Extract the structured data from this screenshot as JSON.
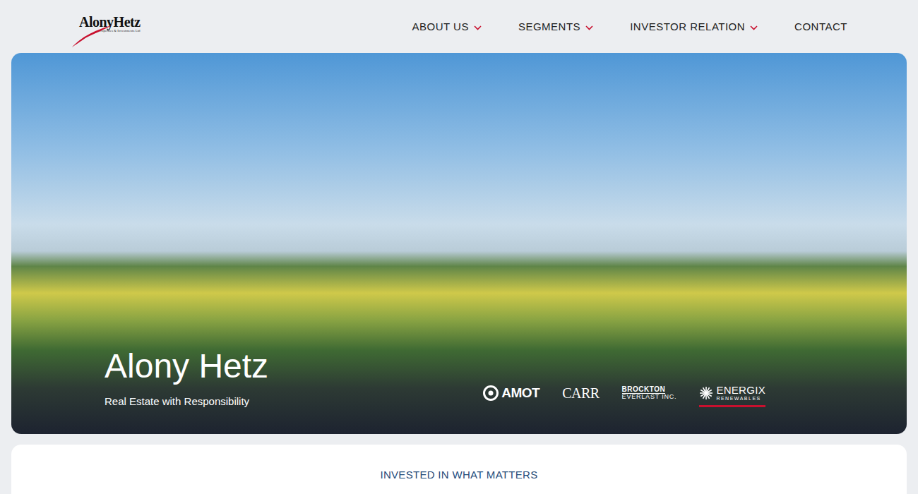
{
  "logo": {
    "name": "AlonyHetz",
    "tagline": "Properties & Investments Ltd"
  },
  "nav": [
    {
      "label": "ABOUT US",
      "dropdown": true
    },
    {
      "label": "SEGMENTS",
      "dropdown": true
    },
    {
      "label": "INVESTOR RELATION",
      "dropdown": true
    },
    {
      "label": "CONTACT",
      "dropdown": false
    }
  ],
  "hero": {
    "title": "Alony Hetz",
    "subtitle": "Real Estate with Responsibility",
    "brands": [
      {
        "name": "AMOT",
        "kind": "icon-wordmark",
        "selected": false
      },
      {
        "name": "CARR",
        "kind": "wordmark",
        "selected": false
      },
      {
        "name": "BROCKTON",
        "sub": "EVERLAST INC.",
        "kind": "stacked",
        "selected": false
      },
      {
        "name": "ENERGIX",
        "sub": "RENEWABLES",
        "kind": "icon-stacked",
        "selected": true
      }
    ]
  },
  "section": {
    "heading": "INVESTED IN WHAT MATTERS"
  }
}
